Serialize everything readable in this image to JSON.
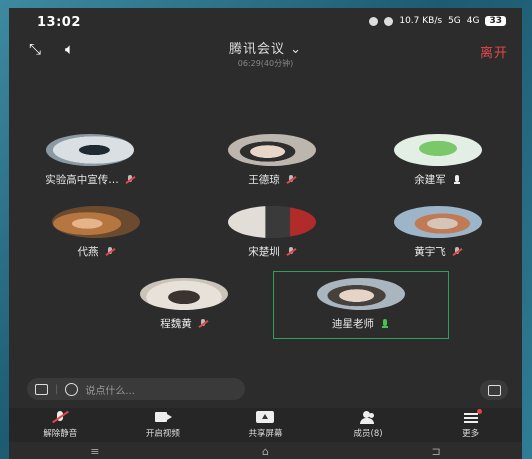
{
  "status_bar": {
    "time": "13:02",
    "speed": "10.7 KB/s",
    "signal1": "5G",
    "signal2": "4G",
    "battery": "33"
  },
  "header": {
    "title": "腾讯会议",
    "subtitle": "06:29(40分钟)",
    "leave_label": "离开"
  },
  "participants": [
    {
      "name": "实验高中宣传…",
      "mic": "muted"
    },
    {
      "name": "王德琼",
      "mic": "muted"
    },
    {
      "name": "余建军",
      "mic": "on"
    },
    {
      "name": "代燕",
      "mic": "muted"
    },
    {
      "name": "宋楚圳",
      "mic": "muted"
    },
    {
      "name": "黄宇飞",
      "mic": "muted"
    },
    {
      "name": "程魏黄",
      "mic": "muted"
    },
    {
      "name": "迪星老师",
      "mic": "speaking"
    }
  ],
  "chat": {
    "placeholder": "说点什么..."
  },
  "toolbar": {
    "unmute_label": "解除静音",
    "video_label": "开启视频",
    "share_label": "共享屏幕",
    "members_label": "成员(8)",
    "more_label": "更多"
  },
  "nav": {
    "menu": "≡",
    "home": "⌂",
    "back": "⊐"
  },
  "colors": {
    "accent_red": "#e04848",
    "active_green": "#2fa05a"
  }
}
